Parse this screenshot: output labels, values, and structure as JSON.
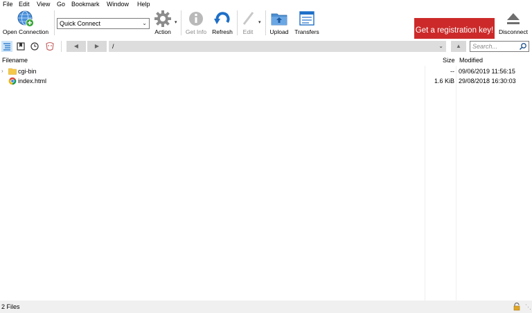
{
  "menu": [
    "File",
    "Edit",
    "View",
    "Go",
    "Bookmark",
    "Window",
    "Help"
  ],
  "toolbar": {
    "open_connection": "Open Connection",
    "quick_connect": "Quick Connect",
    "action": "Action",
    "get_info": "Get Info",
    "refresh": "Refresh",
    "edit": "Edit",
    "upload": "Upload",
    "transfers": "Transfers",
    "registration": "Get a registration key!",
    "disconnect": "Disconnect"
  },
  "navigation": {
    "path": "/",
    "search_placeholder": "Search..."
  },
  "columns": {
    "filename": "Filename",
    "size": "Size",
    "modified": "Modified"
  },
  "files": [
    {
      "name": "cgi-bin",
      "size": "--",
      "modified": "09/06/2019 11:56:15",
      "icon": "folder-icon"
    },
    {
      "name": "index.html",
      "size": "1.6 KiB",
      "modified": "29/08/2018 16:30:03",
      "icon": "html-file-icon"
    }
  ],
  "status": {
    "text": "2 Files"
  },
  "colors": {
    "registration_bg": "#cc2a2a",
    "accent_blue": "#1e6fc8"
  }
}
